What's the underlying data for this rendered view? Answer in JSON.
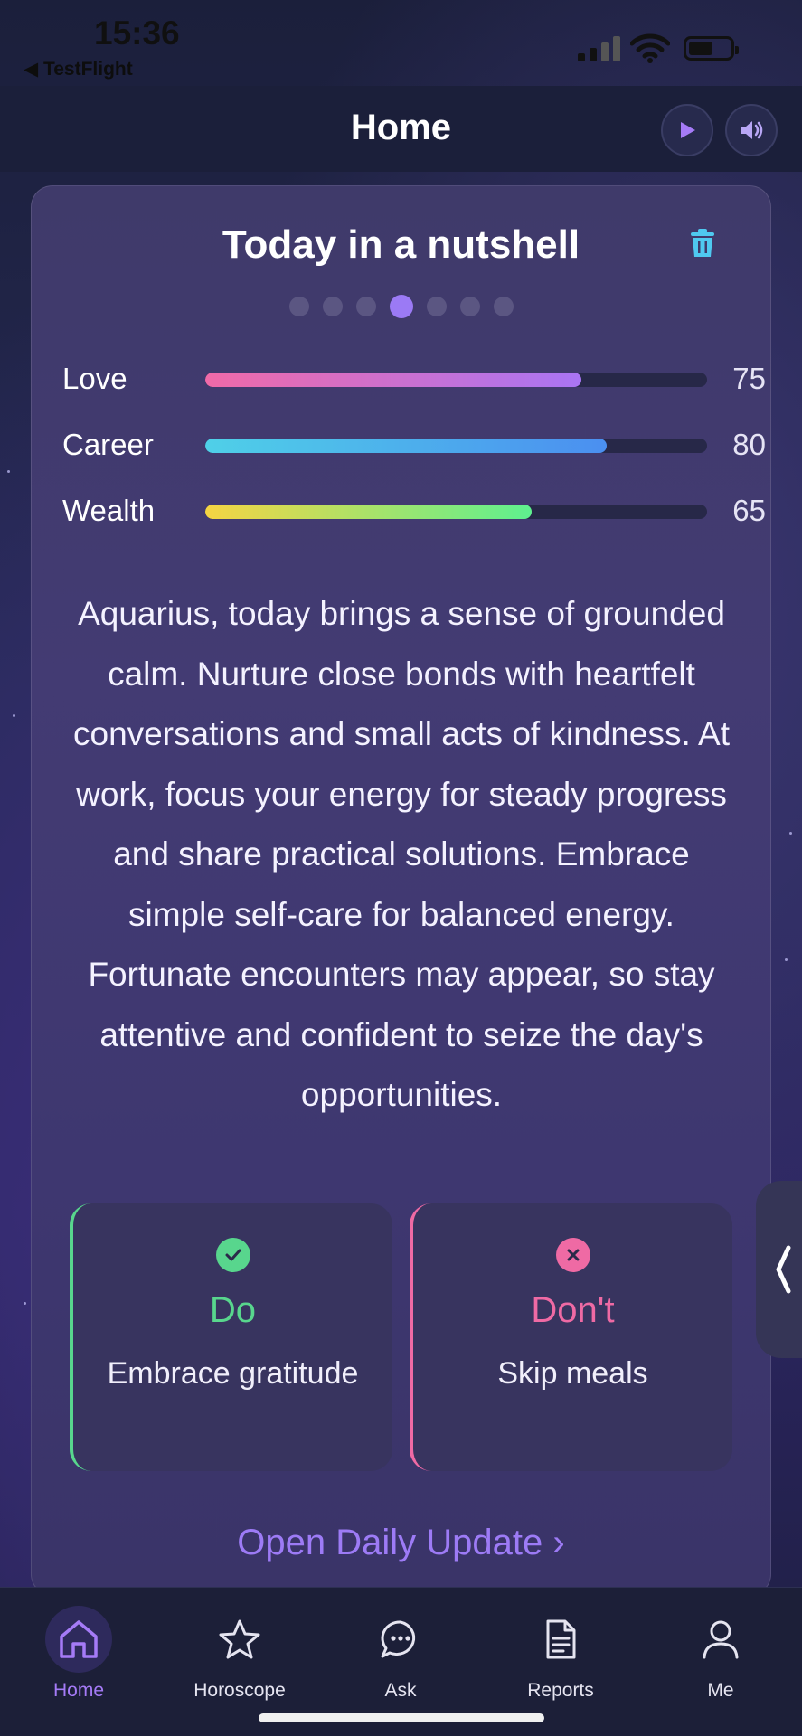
{
  "status_bar": {
    "time": "15:36",
    "back_app": "◀ TestFlight"
  },
  "header": {
    "title": "Home"
  },
  "card": {
    "title": "Today in a nutshell",
    "page_dots": {
      "count": 7,
      "active_index": 3
    },
    "meters": [
      {
        "label": "Love",
        "value": "75",
        "fraction": 0.75
      },
      {
        "label": "Career",
        "value": "80",
        "fraction": 0.8
      },
      {
        "label": "Wealth",
        "value": "65",
        "fraction": 0.65
      }
    ],
    "summary": "Aquarius, today brings a sense of grounded calm. Nurture close bonds with heartfelt conversations and small acts of kindness. At work, focus your energy for steady progress and share practical solutions. Embrace simple self-care for balanced energy. Fortunate encounters may appear, so stay attentive and confident to seize the day's opportunities.",
    "do": {
      "heading": "Do",
      "text": "Embrace gratitude"
    },
    "dont": {
      "heading": "Don't",
      "text": "Skip meals"
    },
    "open_link": "Open Daily Update ›"
  },
  "tabs": [
    {
      "label": "Home",
      "icon": "home-icon",
      "active": true
    },
    {
      "label": "Horoscope",
      "icon": "star-icon",
      "active": false
    },
    {
      "label": "Ask",
      "icon": "chat-icon",
      "active": false
    },
    {
      "label": "Reports",
      "icon": "document-icon",
      "active": false
    },
    {
      "label": "Me",
      "icon": "person-icon",
      "active": false
    }
  ],
  "colors": {
    "accent": "#9b7af5",
    "do_green": "#58d68d",
    "dont_pink": "#ef6aa4",
    "love_gradient": [
      "#f06aa8",
      "#a975f4"
    ],
    "career_gradient": [
      "#4fd0e8",
      "#4b8ff0"
    ],
    "wealth_gradient": [
      "#f5d443",
      "#5ef08f"
    ]
  }
}
